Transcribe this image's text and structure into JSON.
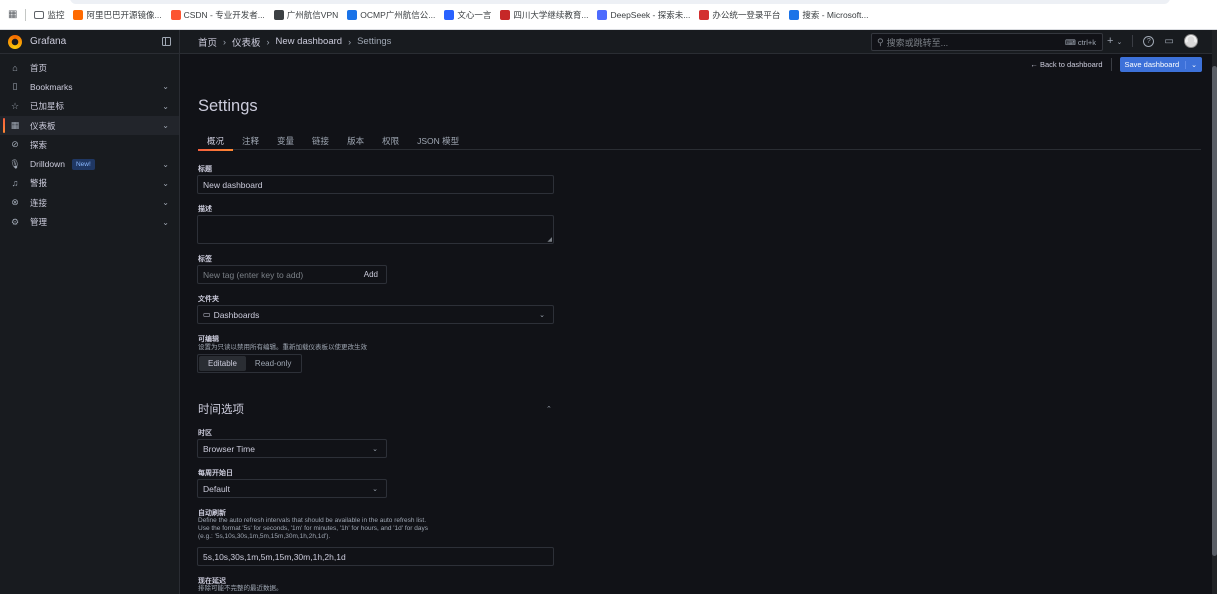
{
  "bookmarks": [
    {
      "label": "监控",
      "icon": "folder-icon",
      "color": "#5f6368"
    },
    {
      "label": "阿里巴巴开源镜像...",
      "icon": "aliyun-icon",
      "color": "#ff6a00"
    },
    {
      "label": "CSDN - 专业开发者...",
      "icon": "csdn-icon",
      "color": "#fc5531"
    },
    {
      "label": "广州航信VPN",
      "icon": "globe-icon",
      "color": "#3c4043"
    },
    {
      "label": "OCMP广州航信公...",
      "icon": "ocmp-icon",
      "color": "#1a73e8"
    },
    {
      "label": "文心一言",
      "icon": "wenxin-icon",
      "color": "#2962ff"
    },
    {
      "label": "四川大学继续教育...",
      "icon": "scu-icon",
      "color": "#c62828"
    },
    {
      "label": "DeepSeek - 探索未...",
      "icon": "deepseek-icon",
      "color": "#4d6bfe"
    },
    {
      "label": "办公统一登录平台",
      "icon": "office-icon",
      "color": "#d32f2f"
    },
    {
      "label": "搜索 - Microsoft...",
      "icon": "search-icon",
      "color": "#1a73e8"
    }
  ],
  "topbar": {
    "brand": "Grafana",
    "breadcrumbs": [
      "首页",
      "仪表板",
      "New dashboard",
      "Settings"
    ],
    "search_placeholder": "搜索或跳转至...",
    "search_shortcut": "ctrl+k",
    "plus": "+",
    "help": "?"
  },
  "sidebar": {
    "items": [
      {
        "label": "首页",
        "icon": "home-icon",
        "glyph": "⌂",
        "chevron": false
      },
      {
        "label": "Bookmarks",
        "icon": "bookmark-icon",
        "glyph": "▯",
        "chevron": true
      },
      {
        "label": "已加星标",
        "icon": "star-icon",
        "glyph": "☆",
        "chevron": true
      },
      {
        "label": "仪表板",
        "icon": "apps-icon",
        "glyph": "▦",
        "chevron": true,
        "active": true
      },
      {
        "label": "探索",
        "icon": "compass-icon",
        "glyph": "⊘",
        "chevron": false
      },
      {
        "label": "Drilldown",
        "icon": "microphone-icon",
        "glyph": "🎙",
        "chevron": true,
        "badge": "New!"
      },
      {
        "label": "警报",
        "icon": "bell-icon",
        "glyph": "♫",
        "chevron": true
      },
      {
        "label": "连接",
        "icon": "link-icon",
        "glyph": "⊗",
        "chevron": true
      },
      {
        "label": "管理",
        "icon": "cog-icon",
        "glyph": "⚙",
        "chevron": true
      }
    ]
  },
  "actions": {
    "back": "← Back to dashboard",
    "save": "Save dashboard"
  },
  "page": {
    "title": "Settings",
    "tabs": [
      "概况",
      "注释",
      "变量",
      "链接",
      "版本",
      "权限",
      "JSON 模型"
    ]
  },
  "general": {
    "title_label": "标题",
    "title_value": "New dashboard",
    "description_label": "描述",
    "tags_label": "标签",
    "tags_placeholder": "New tag (enter key to add)",
    "tags_add": "Add",
    "folder_label": "文件夹",
    "folder_value": "Dashboards",
    "editable_label": "可编辑",
    "editable_desc": "设置为只读以禁用所有编辑。重新加载仪表板以使更改生效",
    "editable_options": [
      "Editable",
      "Read-only"
    ]
  },
  "time": {
    "section_title": "时间选项",
    "timezone_label": "时区",
    "timezone_value": "Browser Time",
    "week_start_label": "每周开始日",
    "week_start_value": "Default",
    "refresh_label": "自动刷新",
    "refresh_desc_1": "Define the auto refresh intervals that should be available in the auto refresh list.",
    "refresh_desc_2": "Use the format '5s' for seconds, '1m' for minutes, '1h' for hours, and '1d' for days",
    "refresh_desc_3": "(e.g.: '5s,10s,30s,1m,5m,15m,30m,1h,2h,1d').",
    "refresh_value": "5s,10s,30s,1m,5m,15m,30m,1h,2h,1d",
    "delay_label": "现在延迟",
    "delay_desc": "排除可能不完整的最近数据。"
  }
}
